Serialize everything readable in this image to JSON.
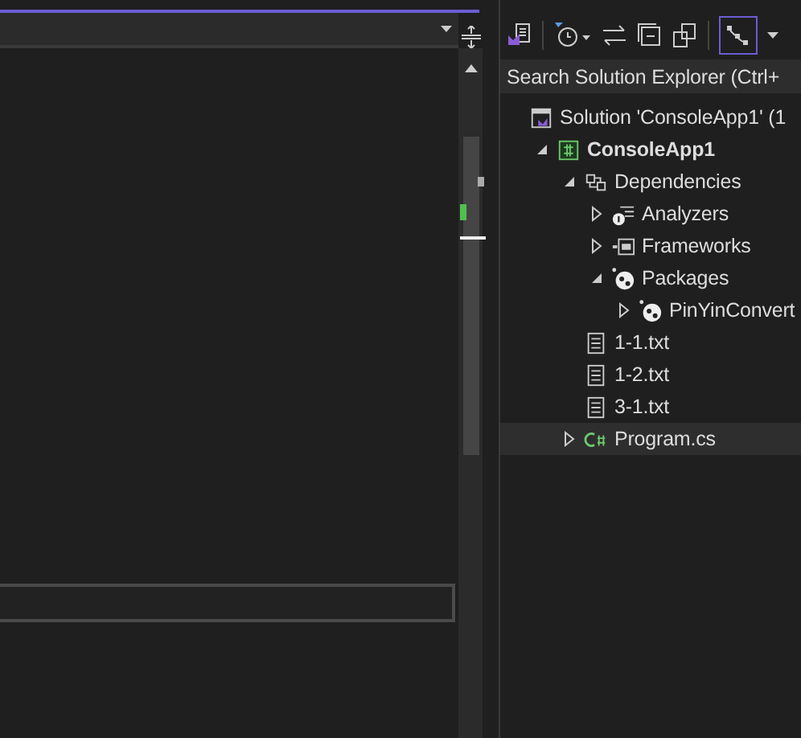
{
  "solution_explorer": {
    "search": {
      "placeholder": "Search Solution Explorer (Ctrl+"
    },
    "tree": [
      {
        "label": "Solution 'ConsoleApp1' (1",
        "kind": "solution",
        "selected": false,
        "children": [
          {
            "label": "ConsoleApp1",
            "kind": "project",
            "selected": false,
            "expanded": true,
            "children": [
              {
                "label": "Dependencies",
                "kind": "dependencies",
                "selected": false,
                "expanded": true,
                "children": [
                  {
                    "label": "Analyzers",
                    "kind": "analyzers",
                    "selected": false,
                    "expanded": false
                  },
                  {
                    "label": "Frameworks",
                    "kind": "frameworks",
                    "selected": false,
                    "expanded": false
                  },
                  {
                    "label": "Packages",
                    "kind": "packages",
                    "selected": false,
                    "expanded": true,
                    "children": [
                      {
                        "label": "PinYinConvert",
                        "kind": "package",
                        "selected": false,
                        "expanded": false
                      }
                    ]
                  }
                ]
              },
              {
                "label": "1-1.txt",
                "kind": "text",
                "selected": false
              },
              {
                "label": "1-2.txt",
                "kind": "text",
                "selected": false
              },
              {
                "label": "3-1.txt",
                "kind": "text",
                "selected": false
              },
              {
                "label": "Program.cs",
                "kind": "csharp",
                "selected": true,
                "expanded": false
              }
            ]
          }
        ]
      }
    ]
  }
}
